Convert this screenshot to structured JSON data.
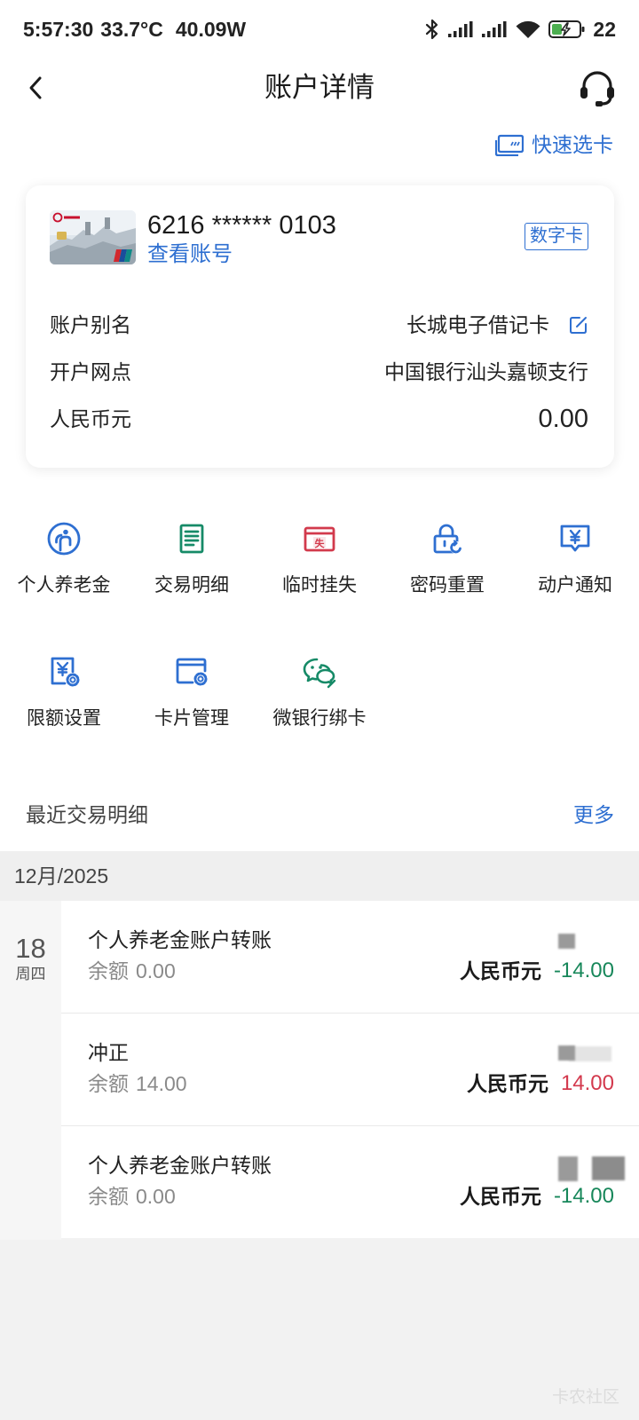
{
  "status_bar": {
    "time": "5:57:30",
    "temperature": "33.7°C",
    "power": "40.09W",
    "battery_level": "22",
    "icons": [
      "bluetooth-icon",
      "signal-icon",
      "signal-icon",
      "wifi-icon",
      "battery-charging-icon"
    ]
  },
  "header": {
    "title": "账户详情",
    "back_icon": "chevron-left-icon",
    "service_icon": "headset-icon"
  },
  "quick_select": {
    "label": "快速选卡",
    "icon": "card-select-icon"
  },
  "account_card": {
    "card_image": "great-wall-debit-card-thumbnail",
    "number": "6216 ****** 0103",
    "view_account_label": "查看账号",
    "badge": "数字卡",
    "rows": [
      {
        "label": "账户别名",
        "value": "长城电子借记卡",
        "icon": "edit-icon"
      },
      {
        "label": "开户网点",
        "value": "中国银行汕头嘉顿支行"
      },
      {
        "label": "人民币元",
        "value": "0.00"
      }
    ]
  },
  "services": [
    {
      "label": "个人养老金",
      "icon": "pension-person-icon",
      "color": "#2e6fd1"
    },
    {
      "label": "交易明细",
      "icon": "transaction-list-icon",
      "color": "#168a67"
    },
    {
      "label": "临时挂失",
      "icon": "card-loss-icon",
      "color": "#d23a4c",
      "glyph": "失"
    },
    {
      "label": "密码重置",
      "icon": "lock-reset-icon",
      "color": "#2e6fd1"
    },
    {
      "label": "动户通知",
      "icon": "yuan-message-icon",
      "color": "#2e6fd1"
    },
    {
      "label": "限额设置",
      "icon": "yuan-settings-icon",
      "color": "#2e6fd1"
    },
    {
      "label": "卡片管理",
      "icon": "card-settings-icon",
      "color": "#2e6fd1"
    },
    {
      "label": "微银行绑卡",
      "icon": "wechat-link-icon",
      "color": "#168a67"
    }
  ],
  "recent": {
    "title": "最近交易明细",
    "more_label": "更多"
  },
  "transactions": {
    "month": "12月/2025",
    "day": "18",
    "weekday": "周四",
    "items": [
      {
        "title": "个人养老金账户转账",
        "balance_label": "余额",
        "balance": "0.00",
        "currency": "人民币元",
        "amount": "-14.00",
        "amount_color": "#17875a"
      },
      {
        "title": "冲正",
        "balance_label": "余额",
        "balance": "14.00",
        "currency": "人民币元",
        "amount": "14.00",
        "amount_color": "#d3394d"
      },
      {
        "title": "个人养老金账户转账",
        "balance_label": "余额",
        "balance": "0.00",
        "currency": "人民币元",
        "amount": "-14.00",
        "amount_color": "#17875a"
      }
    ]
  },
  "watermark": "卡农社区",
  "colors": {
    "accent": "#2e6fd1",
    "debit": "#17875a",
    "credit": "#d3394d",
    "text": "#1b1b1b",
    "muted": "#8a8a8a",
    "section_bg": "#efefef"
  }
}
